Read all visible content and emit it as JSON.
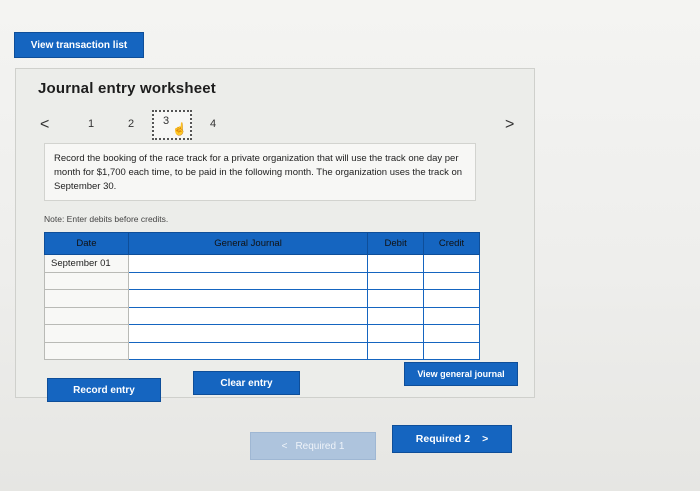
{
  "top": {
    "view_transaction_label": "View transaction list"
  },
  "worksheet": {
    "title": "Journal entry worksheet",
    "nav_prev": "<",
    "nav_next": ">",
    "steps": [
      "1",
      "2",
      "3",
      "4"
    ],
    "prompt": "Record the booking of the race track for a private organization that will use the track one day per month for $1,700 each time, to be paid in the following month. The organization uses the track on September 30.",
    "note": "Note: Enter debits before credits."
  },
  "table": {
    "headers": {
      "date": "Date",
      "journal": "General Journal",
      "debit": "Debit",
      "credit": "Credit"
    },
    "first_date": "September 01"
  },
  "buttons": {
    "record_entry": "Record entry",
    "clear_entry": "Clear entry",
    "view_general_journal": "View general journal"
  },
  "footer": {
    "required_prev_arrow": "<",
    "required_prev": "Required 1",
    "required_next": "Required 2",
    "required_next_arrow": ">"
  },
  "colors": {
    "accent": "#1565c0"
  }
}
